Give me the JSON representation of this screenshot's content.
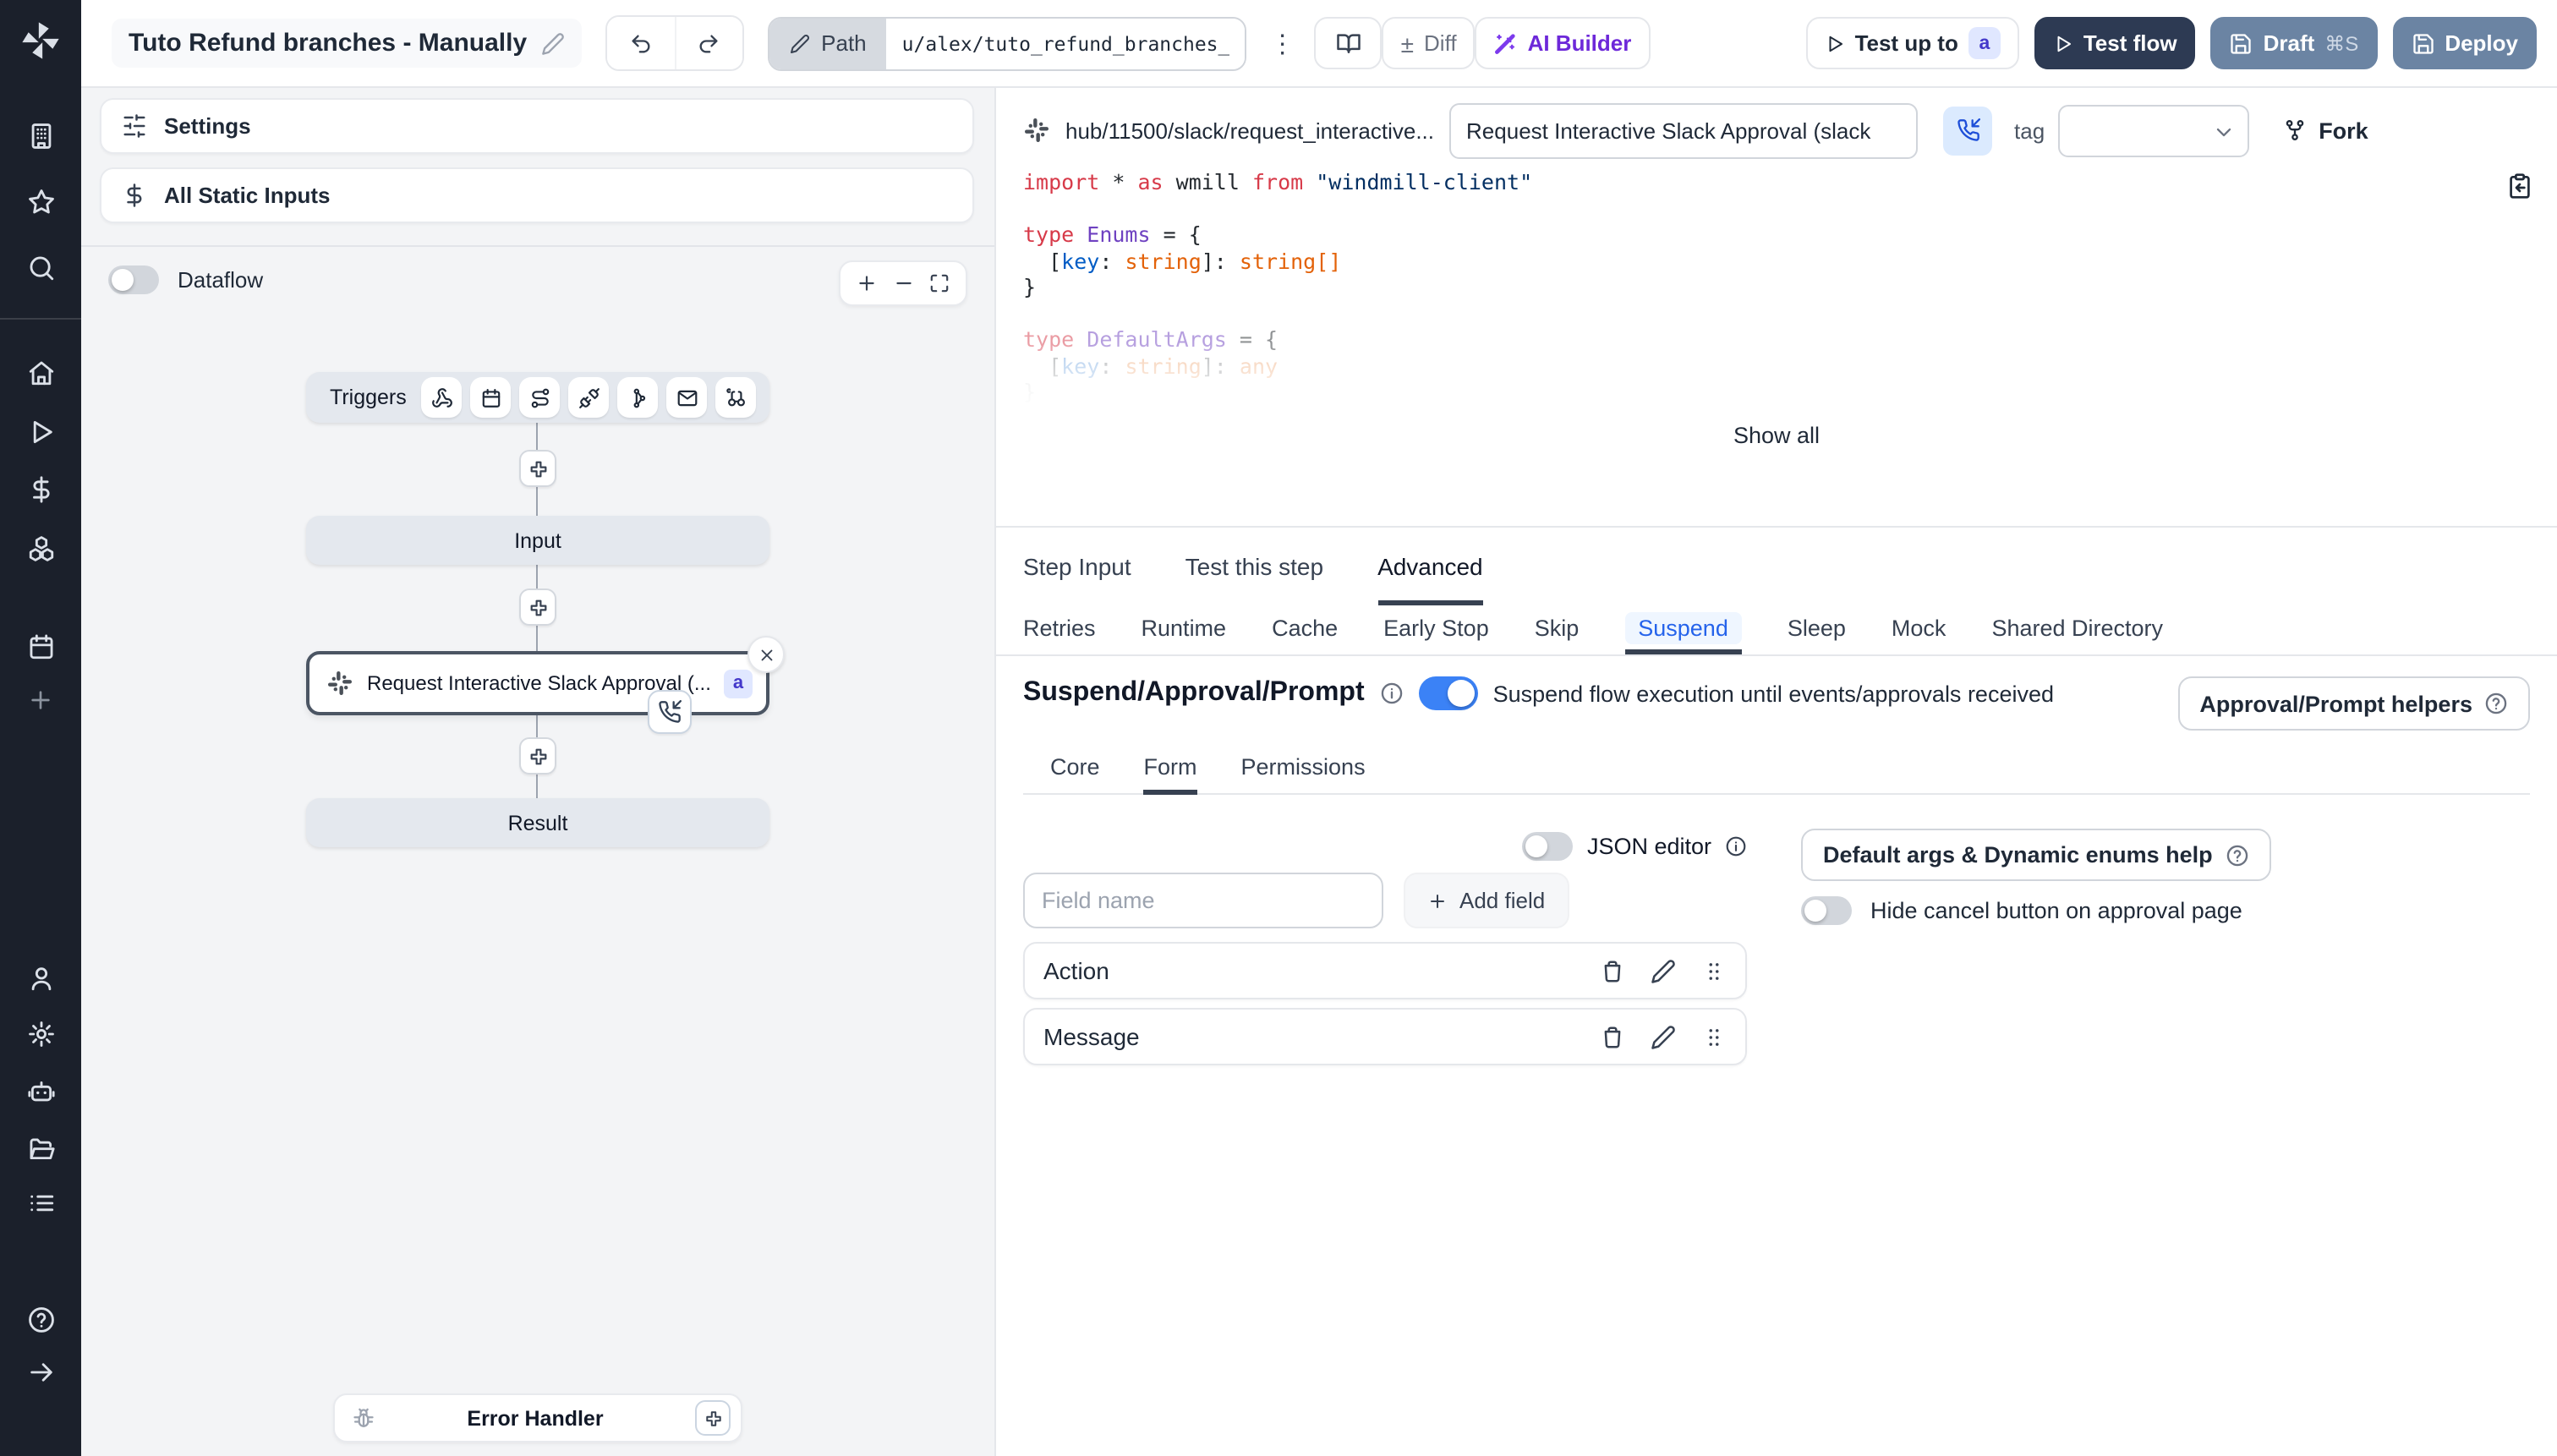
{
  "header": {
    "title": "Tuto Refund branches - Manually",
    "path_label": "Path",
    "path_value": "u/alex/tuto_refund_branches__",
    "diff_sign": "±",
    "diff_label": "Diff",
    "ai_builder_label": "AI Builder",
    "test_up_to_label": "Test up to",
    "test_up_to_badge": "a",
    "test_flow_label": "Test flow",
    "draft_label": "Draft",
    "draft_shortcut": "⌘S",
    "deploy_label": "Deploy",
    "kebab_glyph": "⋮"
  },
  "left_panel": {
    "settings_label": "Settings",
    "static_inputs_label": "All Static Inputs",
    "dataflow_label": "Dataflow"
  },
  "flow": {
    "triggers_label": "Triggers",
    "input_label": "Input",
    "node_label": "Request Interactive Slack Approval (...",
    "node_badge": "a",
    "result_label": "Result",
    "error_handler_label": "Error Handler"
  },
  "script": {
    "hub_path": "hub/11500/slack/request_interactive...",
    "name_value": "Request Interactive Slack Approval (slack",
    "tag_label": "tag",
    "fork_label": "Fork",
    "show_all_label": "Show all"
  },
  "editor": {
    "lines": [
      {
        "tokens": [
          {
            "t": "import",
            "c": "kw"
          },
          {
            "t": " * ",
            "c": "pl"
          },
          {
            "t": "as",
            "c": "kw"
          },
          {
            "t": " wmill ",
            "c": "pl"
          },
          {
            "t": "from",
            "c": "kw"
          },
          {
            "t": " ",
            "c": "pl"
          },
          {
            "t": "\"windmill-client\"",
            "c": "str"
          }
        ]
      },
      {
        "tokens": []
      },
      {
        "tokens": [
          {
            "t": "type",
            "c": "kw"
          },
          {
            "t": " ",
            "c": "pl"
          },
          {
            "t": "Enums",
            "c": "tp"
          },
          {
            "t": " = {",
            "c": "pl"
          }
        ]
      },
      {
        "tokens": [
          {
            "t": "  [",
            "c": "pl"
          },
          {
            "t": "key",
            "c": "prop"
          },
          {
            "t": ": ",
            "c": "pl"
          },
          {
            "t": "string",
            "c": "num"
          },
          {
            "t": "]: ",
            "c": "pl"
          },
          {
            "t": "string",
            "c": "num"
          },
          {
            "t": "[]",
            "c": "num"
          }
        ]
      },
      {
        "tokens": [
          {
            "t": "}",
            "c": "pl"
          }
        ]
      },
      {
        "tokens": []
      },
      {
        "tokens": [
          {
            "t": "type",
            "c": "kw"
          },
          {
            "t": " ",
            "c": "pl"
          },
          {
            "t": "DefaultArgs",
            "c": "tp"
          },
          {
            "t": " = {",
            "c": "pl"
          }
        ]
      },
      {
        "tokens": [
          {
            "t": "  [",
            "c": "pl"
          },
          {
            "t": "key",
            "c": "prop"
          },
          {
            "t": ": ",
            "c": "pl"
          },
          {
            "t": "string",
            "c": "num"
          },
          {
            "t": "]: ",
            "c": "pl"
          },
          {
            "t": "any",
            "c": "num"
          }
        ]
      },
      {
        "tokens": [
          {
            "t": "}",
            "c": "pl"
          }
        ]
      }
    ]
  },
  "tabs": {
    "items": [
      {
        "label": "Step Input"
      },
      {
        "label": "Test this step"
      },
      {
        "label": "Advanced"
      }
    ],
    "active": "Advanced"
  },
  "subtabs": {
    "items": [
      {
        "label": "Retries"
      },
      {
        "label": "Runtime"
      },
      {
        "label": "Cache"
      },
      {
        "label": "Early Stop"
      },
      {
        "label": "Skip"
      },
      {
        "label": "Suspend"
      },
      {
        "label": "Sleep"
      },
      {
        "label": "Mock"
      },
      {
        "label": "Shared Directory"
      }
    ],
    "active": "Suspend"
  },
  "suspend": {
    "heading": "Suspend/Approval/Prompt",
    "toggle_description": "Suspend flow execution until events/approvals received",
    "helpers_button": "Approval/Prompt helpers",
    "inner_tabs": [
      {
        "label": "Core"
      },
      {
        "label": "Form"
      },
      {
        "label": "Permissions"
      }
    ],
    "inner_active": "Form",
    "json_editor_label": "JSON editor",
    "field_name_placeholder": "Field name",
    "add_field_label": "Add field",
    "fields": [
      {
        "name": "Action"
      },
      {
        "name": "Message"
      }
    ],
    "default_args_button": "Default args & Dynamic enums help",
    "hide_cancel_label": "Hide cancel button on approval page"
  },
  "colors": {
    "sidebar_bg": "#1b202b",
    "toggle_on": "#3b82f6",
    "active_subtab_text": "#2563eb",
    "active_subtab_bg": "#eff6ff",
    "badge_bg": "#e0e7ff",
    "badge_text": "#4338ca",
    "test_flow_bg": "#2d3a53",
    "draft_deploy_bg": "#6b84a3",
    "ai_builder_text": "#6d28d9"
  }
}
